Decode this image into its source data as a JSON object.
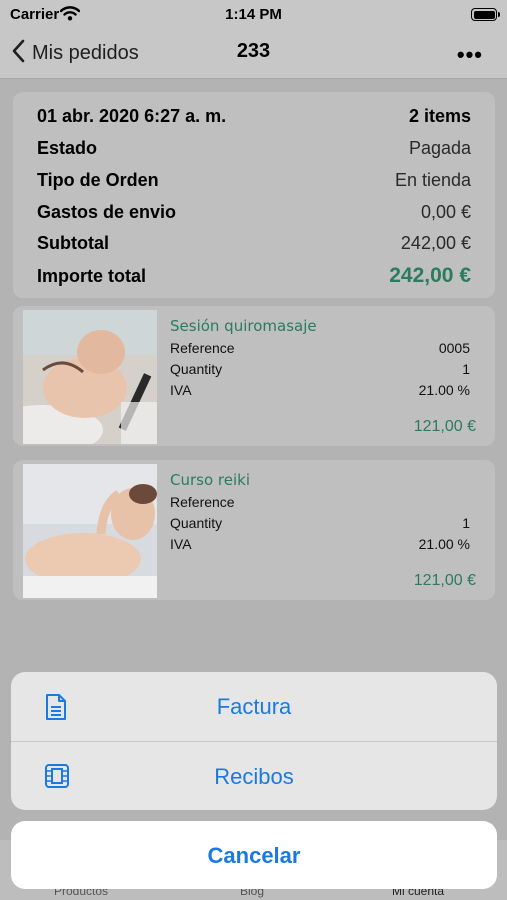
{
  "status_bar": {
    "carrier": "Carrier",
    "time": "1:14 PM"
  },
  "nav": {
    "back_label": "Mis pedidos",
    "title": "233",
    "more": "•••"
  },
  "order": {
    "date": "01 abr. 2020 6:27 a. m.",
    "items_count": "2 items",
    "rows": [
      {
        "label": "Estado",
        "value": "Pagada"
      },
      {
        "label": "Tipo de Orden",
        "value": "En tienda"
      },
      {
        "label": "Gastos de envio",
        "value": "0,00 €"
      },
      {
        "label": "Subtotal",
        "value": "242,00 €"
      }
    ],
    "total_label": "Importe total",
    "total_value": "242,00 €"
  },
  "items": [
    {
      "title": "Sesión quiromasaje",
      "reference_label": "Reference",
      "reference": "0005",
      "quantity_label": "Quantity",
      "quantity": "1",
      "iva_label": "IVA",
      "iva": "21.00 %",
      "price": "121,00 €"
    },
    {
      "title": "Curso reiki",
      "reference_label": "Reference",
      "reference": "",
      "quantity_label": "Quantity",
      "quantity": "1",
      "iva_label": "IVA",
      "iva": "21.00 %",
      "price": "121,00 €"
    }
  ],
  "tabbar": {
    "tabs": [
      "Productos",
      "Blog",
      "Mi cuenta"
    ]
  },
  "action_sheet": {
    "actions": [
      {
        "label": "Factura",
        "icon": "document-icon"
      },
      {
        "label": "Recibos",
        "icon": "film-icon"
      }
    ],
    "cancel_label": "Cancelar"
  },
  "colors": {
    "accent": "#1a7ae0",
    "price_green": "#2b7b5e"
  }
}
